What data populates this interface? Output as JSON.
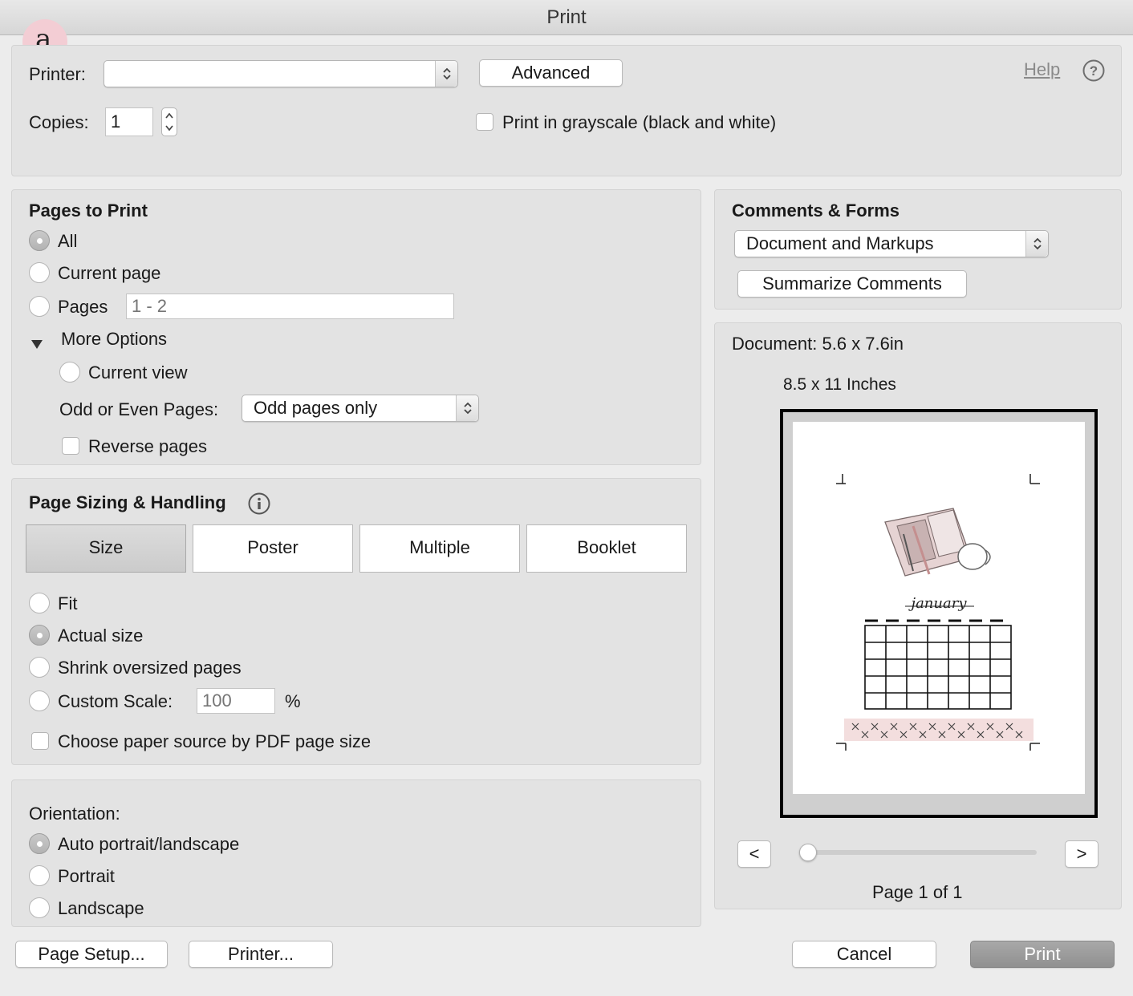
{
  "window": {
    "title": "Print",
    "badge": "a."
  },
  "printer": {
    "label": "Printer:",
    "value": "",
    "advanced_label": "Advanced",
    "help_label": "Help",
    "copies_label": "Copies:",
    "copies_value": "1",
    "grayscale_label": "Print in grayscale (black and white)",
    "grayscale_checked": false
  },
  "pages_to_print": {
    "heading": "Pages to Print",
    "all_label": "All",
    "current_page_label": "Current page",
    "pages_label": "Pages",
    "pages_placeholder": "1 - 2",
    "more_options_label": "More Options",
    "current_view_label": "Current view",
    "odd_even_label": "Odd or Even Pages:",
    "odd_even_value": "Odd pages only",
    "reverse_label": "Reverse pages",
    "selected": "All"
  },
  "page_sizing": {
    "heading": "Page Sizing & Handling",
    "tabs": [
      "Size",
      "Poster",
      "Multiple",
      "Booklet"
    ],
    "active_tab": "Size",
    "fit_label": "Fit",
    "actual_size_label": "Actual size",
    "shrink_label": "Shrink oversized pages",
    "custom_scale_label": "Custom Scale:",
    "custom_scale_placeholder": "100",
    "percent": "%",
    "paper_source_label": "Choose paper source by PDF page size",
    "selected": "Actual size"
  },
  "orientation": {
    "heading": "Orientation:",
    "auto_label": "Auto portrait/landscape",
    "portrait_label": "Portrait",
    "landscape_label": "Landscape",
    "selected": "Auto portrait/landscape"
  },
  "comments_forms": {
    "heading": "Comments & Forms",
    "select_value": "Document and Markups",
    "summarize_label": "Summarize Comments"
  },
  "preview": {
    "document_label": "Document: 5.6 x 7.6in",
    "paper_label": "8.5 x 11 Inches",
    "prev_label": "<",
    "next_label": ">",
    "page_indicator": "Page 1 of 1",
    "calendar_title": "january",
    "slider_position": 0
  },
  "footer": {
    "page_setup_label": "Page Setup...",
    "printer_label": "Printer...",
    "cancel_label": "Cancel",
    "print_label": "Print"
  }
}
